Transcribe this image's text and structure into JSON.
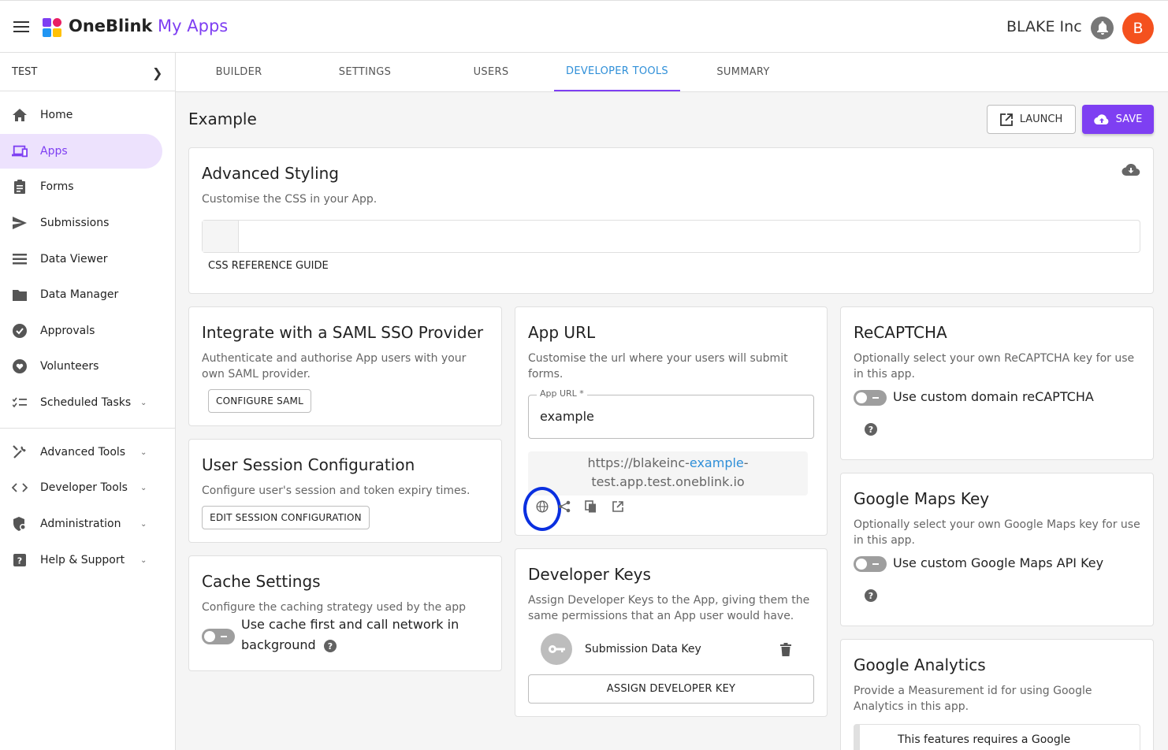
{
  "header": {
    "brand_bold": "OneBlink",
    "brand_tail": " My Apps",
    "org_name": "BLAKE Inc",
    "avatar_initial": "B",
    "colors": {
      "accent": "#7e3ff2",
      "link": "#2f8fd8",
      "avatar": "#f4511e"
    }
  },
  "sidebar": {
    "project": "TEST",
    "items": [
      {
        "label": "Home",
        "icon": "home-icon"
      },
      {
        "label": "Apps",
        "icon": "devices-icon",
        "active": true
      },
      {
        "label": "Forms",
        "icon": "clipboard-icon"
      },
      {
        "label": "Submissions",
        "icon": "send-icon"
      },
      {
        "label": "Data Viewer",
        "icon": "list-icon"
      },
      {
        "label": "Data Manager",
        "icon": "folder-icon"
      },
      {
        "label": "Approvals",
        "icon": "check-circle-icon"
      },
      {
        "label": "Volunteers",
        "icon": "heart-hand-icon"
      },
      {
        "label": "Scheduled Tasks",
        "icon": "checklist-icon"
      },
      {
        "label": "Advanced Tools",
        "icon": "tools-icon"
      },
      {
        "label": "Developer Tools",
        "icon": "code-icon"
      },
      {
        "label": "Administration",
        "icon": "admin-shield-icon"
      },
      {
        "label": "Help & Support",
        "icon": "help-box-icon"
      }
    ]
  },
  "tabs": [
    "BUILDER",
    "SETTINGS",
    "USERS",
    "DEVELOPER TOOLS",
    "SUMMARY"
  ],
  "page": {
    "title": "Example",
    "launch_label": "LAUNCH",
    "save_label": "SAVE"
  },
  "advanced_styling": {
    "title": "Advanced Styling",
    "desc": "Customise the CSS in your App.",
    "guide_label": "CSS REFERENCE GUIDE"
  },
  "saml": {
    "title": "Integrate with a SAML SSO Provider",
    "desc": "Authenticate and authorise App users with your own SAML provider.",
    "button": "CONFIGURE SAML"
  },
  "session": {
    "title": "User Session Configuration",
    "desc": "Configure user's session and token expiry times.",
    "button": "EDIT SESSION CONFIGURATION"
  },
  "cache": {
    "title": "Cache Settings",
    "desc": "Configure the caching strategy used by the app",
    "toggle_line1": "Use cache first and call network in",
    "toggle_line2": "background"
  },
  "app_url": {
    "title": "App URL",
    "desc": "Customise the url where your users will submit forms.",
    "field_label": "App URL *",
    "field_value": "example",
    "url_prefix": "https://blakeinc-",
    "url_highlight": "example",
    "url_suffix_1": "-",
    "url_suffix_2": "test.app.test.oneblink.io"
  },
  "dev_keys": {
    "title": "Developer Keys",
    "desc": "Assign Developer Keys to the App, giving them the same permissions that an App user would have.",
    "key_name": "Submission Data Key",
    "assign_button": "ASSIGN DEVELOPER KEY"
  },
  "recaptcha": {
    "title": "ReCAPTCHA",
    "desc": "Optionally select your own ReCAPTCHA key for use in this app.",
    "toggle_label": "Use custom domain reCAPTCHA"
  },
  "maps": {
    "title": "Google Maps Key",
    "desc": "Optionally select your own Google Maps key for use in this app.",
    "toggle_label": "Use custom Google Maps API Key"
  },
  "analytics": {
    "title": "Google Analytics",
    "desc": "Provide a Measurement id for using Google Analytics in this app.",
    "notice": "This features requires a Google"
  }
}
